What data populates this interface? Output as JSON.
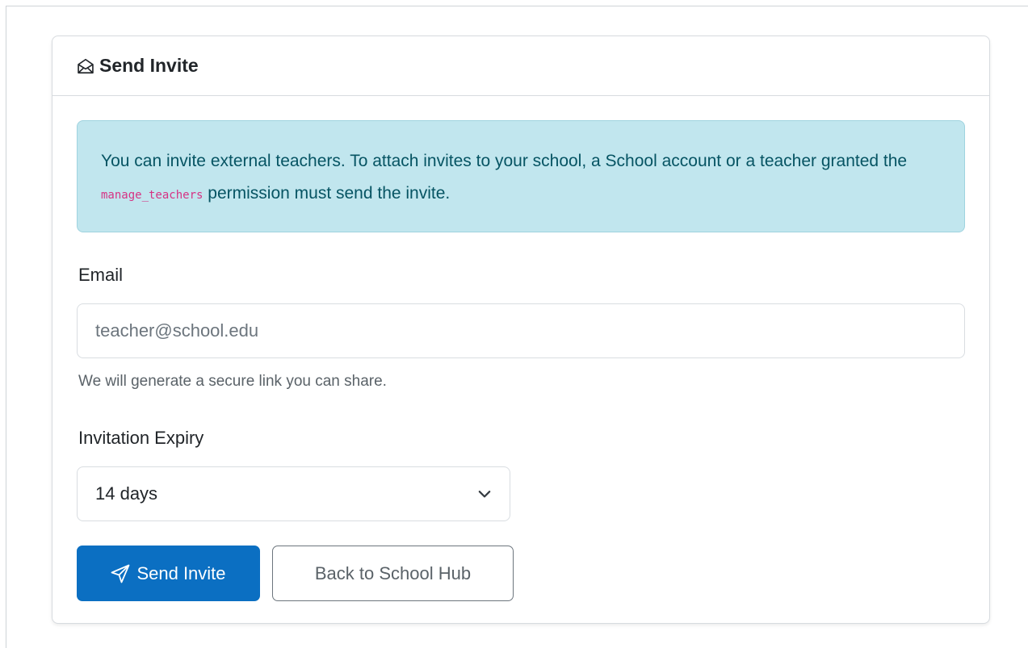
{
  "card": {
    "title": "Send Invite",
    "title_icon": "envelope-open-icon"
  },
  "alert": {
    "text_before": "You can invite external teachers. To attach invites to your school, a School account or a teacher granted the ",
    "code": "manage_teachers",
    "text_after": " permission must send the invite."
  },
  "form": {
    "email_label": "Email",
    "email_placeholder": "teacher@school.edu",
    "email_value": "",
    "email_help": "We will generate a secure link you can share.",
    "expiry_label": "Invitation Expiry",
    "expiry_selected": "14 days",
    "expiry_icon": "chevron-down-icon"
  },
  "actions": {
    "send_label": "Send Invite",
    "send_icon": "send-icon",
    "back_label": "Back to School Hub"
  },
  "colors": {
    "primary": "#0b6fc2",
    "alert_bg": "#c1e6ee",
    "alert_text": "#065463",
    "code": "#d63384"
  }
}
